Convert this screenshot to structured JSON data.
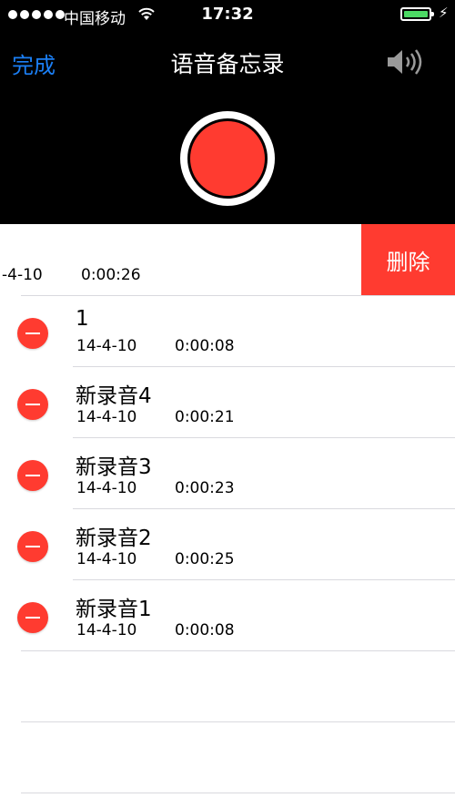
{
  "status_bar": {
    "carrier": "中国移动",
    "time": "17:32",
    "battery_color": "#4cd964"
  },
  "nav": {
    "done_label": "完成",
    "title": "语音备忘录",
    "speaker_icon": "speaker-icon",
    "done_color": "#1b7ff5"
  },
  "record_button": {
    "color": "#ff3b30",
    "icon": "record-icon"
  },
  "swiped_row": {
    "date": "-4-10",
    "duration": "0:00:26",
    "delete_label": "删除"
  },
  "recordings": [
    {
      "name": "1",
      "date": "14-4-10",
      "duration": "0:00:08"
    },
    {
      "name": "新录音4",
      "date": "14-4-10",
      "duration": "0:00:21"
    },
    {
      "name": "新录音3",
      "date": "14-4-10",
      "duration": "0:00:23"
    },
    {
      "name": "新录音2",
      "date": "14-4-10",
      "duration": "0:00:25"
    },
    {
      "name": "新录音1",
      "date": "14-4-10",
      "duration": "0:00:08"
    }
  ]
}
